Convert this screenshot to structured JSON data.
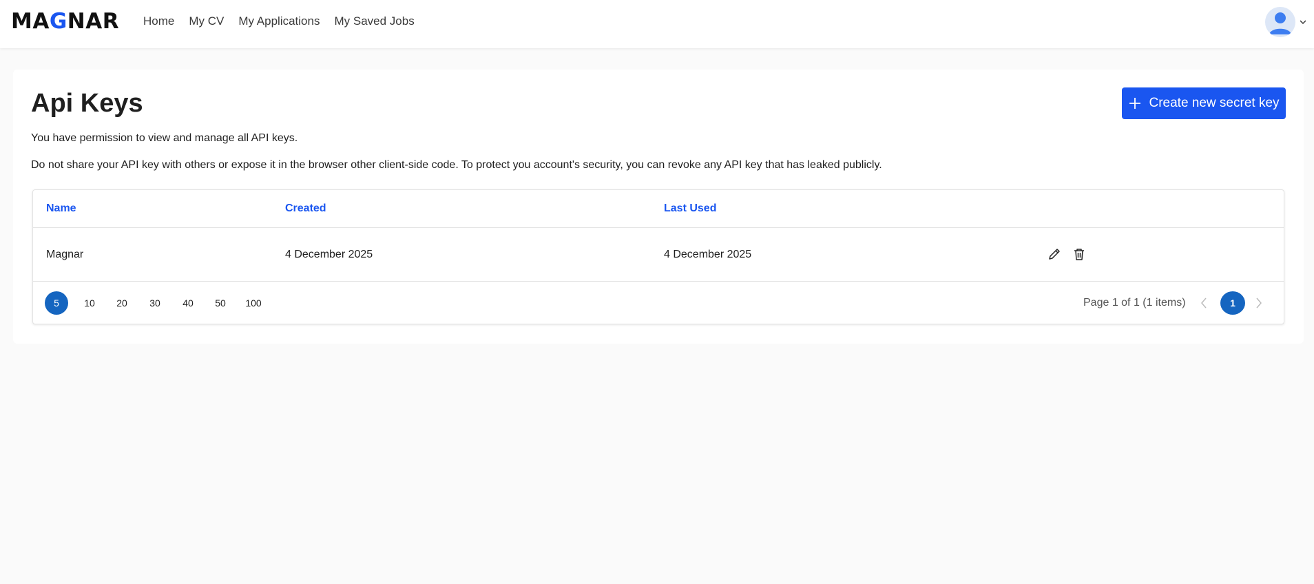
{
  "header": {
    "logo_pre": "MA",
    "logo_accent": "G",
    "logo_post": "NAR",
    "nav": [
      "Home",
      "My CV",
      "My Applications",
      "My Saved Jobs"
    ],
    "brand_color": "#1a56f0"
  },
  "page": {
    "title": "Api Keys",
    "description_1": "You have permission to view and manage all API keys.",
    "description_2": "Do not share your API key with others or expose it in the browser other client-side code. To protect you account's security, you can revoke any API key that has leaked publicly.",
    "create_button_label": "Create new secret key"
  },
  "table": {
    "columns": [
      "Name",
      "Created",
      "Last Used"
    ],
    "rows": [
      {
        "name": "Magnar",
        "created": "4 December 2025",
        "last_used": "4 December 2025"
      }
    ]
  },
  "pagination": {
    "page_sizes": [
      "5",
      "10",
      "20",
      "30",
      "40",
      "50",
      "100"
    ],
    "selected_page_size": "5",
    "info": "Page 1 of 1 (1 items)",
    "current_page": "1"
  },
  "icons": {
    "plus": "plus-icon",
    "edit": "pencil-icon",
    "delete": "trash-icon",
    "avatar": "user-avatar-icon",
    "dropdown": "chevron-down-icon",
    "prev": "chevron-left-icon",
    "next": "chevron-right-icon"
  }
}
